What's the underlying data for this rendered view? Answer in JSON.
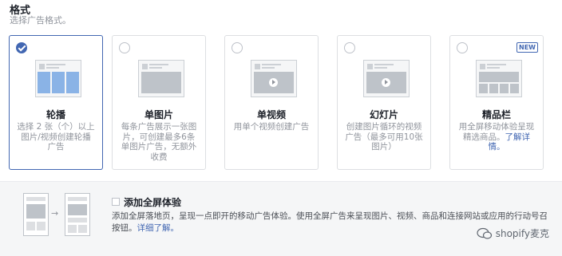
{
  "format": {
    "title": "格式",
    "subtitle": "选择广告格式。"
  },
  "cards": [
    {
      "title": "轮播",
      "desc": "选择 2 张（个）以上图片/视频创建轮播广告",
      "selected": true
    },
    {
      "title": "单图片",
      "desc": "每条广告展示一张图片，可创建最多6条单图片广告，无额外收费"
    },
    {
      "title": "单视频",
      "desc": "用单个视频创建广告"
    },
    {
      "title": "幻灯片",
      "desc": "创建图片循环的视频广告（最多可用10张图片）"
    },
    {
      "title": "精品栏",
      "desc": "用全屏移动体验呈现精选商品。",
      "link": "了解详情。",
      "badge": "NEW"
    }
  ],
  "fullscreen": {
    "title": "添加全屏体验",
    "desc": "添加全屏落地页，呈现一点即开的移动广告体验。使用全屏广告来呈现图片、视频、商品和连接网站或应用的行动号召按钮。",
    "link": "详细了解。",
    "arrow": "→"
  },
  "watermark": {
    "text": "shopify麦克"
  },
  "colors": {
    "accent": "#4267b2",
    "selected_border": "#4267b2",
    "muted_text": "#90949c",
    "panel_bg": "#f5f6f7"
  }
}
